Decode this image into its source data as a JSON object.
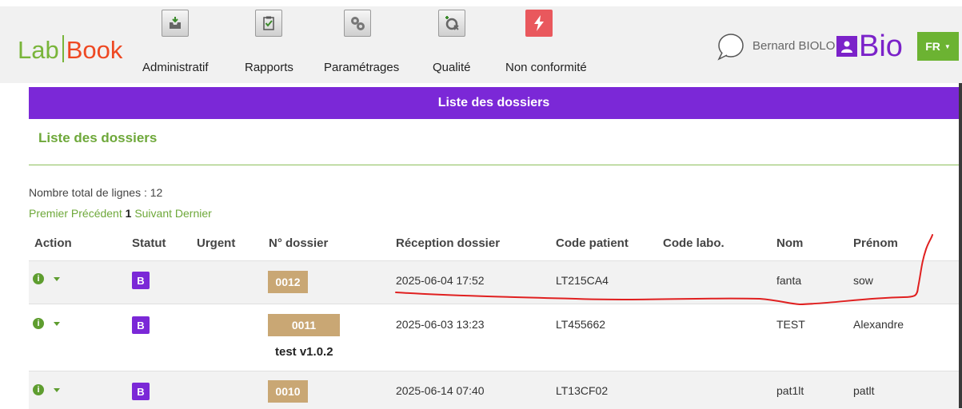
{
  "app": {
    "logo_left": "Lab",
    "logo_right": "Book"
  },
  "nav": {
    "administratif": "Administratif",
    "rapports": "Rapports",
    "parametrages": "Paramétrages",
    "qualite": "Qualité",
    "non_conformite": "Non conformité"
  },
  "user": {
    "name": "Bernard BIOLO",
    "bio_logo": "Bio",
    "language": "FR"
  },
  "page": {
    "title_bar": "Liste des dossiers",
    "section_title": "Liste des dossiers",
    "total_lines": "Nombre total de lignes : 12",
    "pager": {
      "first": "Premier",
      "prev": "Précédent",
      "current": "1",
      "next": "Suivant",
      "last": "Dernier"
    }
  },
  "table": {
    "headers": [
      "Action",
      "Statut",
      "Urgent",
      "N° dossier",
      "Réception dossier",
      "Code patient",
      "Code labo.",
      "Nom",
      "Prénom"
    ],
    "rows": [
      {
        "statut": "B",
        "urgent": "",
        "dossier": "0012",
        "note": "",
        "reception": "2025-06-04 17:52",
        "code_patient": "LT215CA4",
        "code_labo": "",
        "nom": "fanta",
        "prenom": "sow"
      },
      {
        "statut": "B",
        "urgent": "",
        "dossier": "0011",
        "note": "test v1.0.2",
        "reception": "2025-06-03 13:23",
        "code_patient": "LT455662",
        "code_labo": "",
        "nom": "TEST",
        "prenom": "Alexandre"
      },
      {
        "statut": "B",
        "urgent": "",
        "dossier": "0010",
        "note": "",
        "reception": "2025-06-14 07:40",
        "code_patient": "LT13CF02",
        "code_labo": "",
        "nom": "pat1lt",
        "prenom": "patlt"
      }
    ]
  },
  "colors": {
    "purple": "#7b28d7",
    "green": "#6cb332",
    "gold": "#c9a774",
    "annotation_red": "#e02020"
  }
}
